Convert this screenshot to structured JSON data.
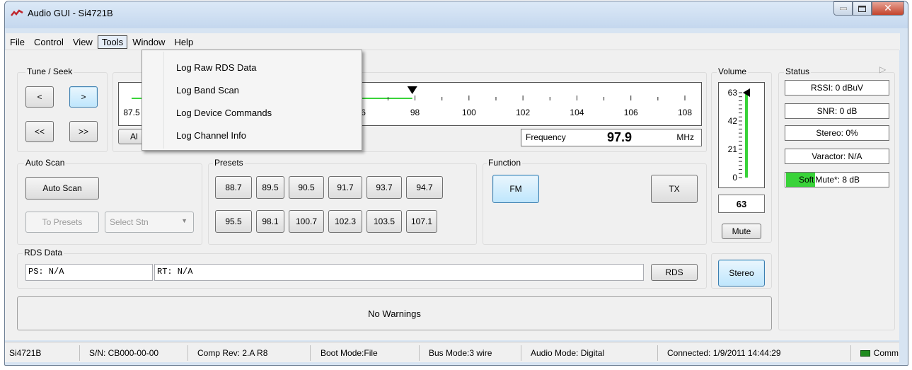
{
  "window": {
    "title": "Audio GUI - Si4721B"
  },
  "menu": [
    {
      "label": "File"
    },
    {
      "label": "Control"
    },
    {
      "label": "View"
    },
    {
      "label": "Tools"
    },
    {
      "label": "Window"
    },
    {
      "label": "Help"
    }
  ],
  "tools_menu": [
    {
      "label": "Log Raw RDS Data"
    },
    {
      "label": "Log Band Scan"
    },
    {
      "label": "Log Device Commands"
    },
    {
      "label": "Log Channel Info"
    }
  ],
  "tune_seek": {
    "label": "Tune / Seek",
    "prev": "<",
    "next": ">",
    "seek_prev": "<<",
    "seek_next": ">>"
  },
  "dial": {
    "ticks": [
      "87.5",
      "96",
      "98",
      "100",
      "102",
      "104",
      "106",
      "108"
    ],
    "partial_button": "Al",
    "frequency_label": "Frequency",
    "frequency_value": "97.9",
    "frequency_unit": "MHz",
    "marker_value": 97.9
  },
  "auto_scan": {
    "label": "Auto Scan",
    "button": "Auto Scan",
    "to_presets": "To Presets",
    "select": "Select Stn"
  },
  "presets": {
    "label": "Presets",
    "row1": [
      "88.7",
      "89.5",
      "90.5",
      "91.7",
      "93.7",
      "94.7"
    ],
    "row2": [
      "95.5",
      "98.1",
      "100.7",
      "102.3",
      "103.5",
      "107.1"
    ]
  },
  "function": {
    "label": "Function",
    "fm": "FM",
    "tx": "TX"
  },
  "volume": {
    "label": "Volume",
    "ticks": [
      "63",
      "42",
      "21",
      "0"
    ],
    "value": "63",
    "level": 1.0,
    "mute": "Mute"
  },
  "status": {
    "label": "Status",
    "rssi": "RSSI: 0 dBuV",
    "snr": "SNR: 0 dB",
    "stereo": "Stereo: 0%",
    "varactor": "Varactor: N/A",
    "softmute_highlight": "Soft",
    "softmute_rest": " Mute*: 8 dB"
  },
  "rds": {
    "label": "RDS Data",
    "ps": "PS: N/A",
    "rt": "RT: N/A",
    "button": "RDS"
  },
  "stereo_button": "Stereo",
  "warnings": "No Warnings",
  "statusbar": {
    "chip": "Si4721B",
    "serial": "S/N: CB000-00-00",
    "comp_rev": "Comp Rev: 2.A R8",
    "boot_mode": "Boot Mode:File",
    "bus_mode": "Bus Mode:3 wire",
    "audio_mode": "Audio Mode: Digital",
    "connected": "Connected: 1/9/2011 14:44:29",
    "comm": "Comm"
  },
  "colors": {
    "accent_green": "#39d339",
    "comm_green": "#1f8b1f"
  }
}
